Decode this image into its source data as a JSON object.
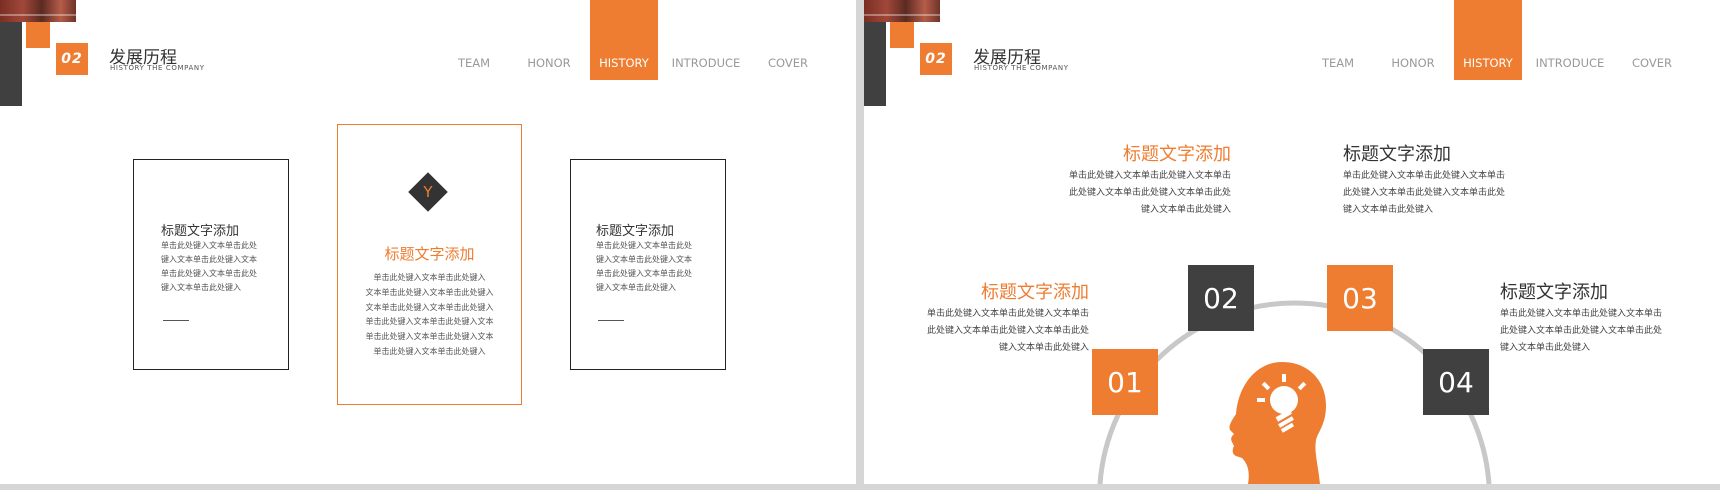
{
  "header": {
    "num": "02",
    "title": "发展历程",
    "subtitle": "HISTORY  THE  COMPANY"
  },
  "nav": [
    "TEAM",
    "HONOR",
    "HISTORY",
    "INTRODUCE",
    "COVER"
  ],
  "nav_active": "HISTORY",
  "left_slide": {
    "card1": {
      "title": "标题文字添加",
      "lines": [
        "单击此处键入文本单击此处",
        "键入文本单击此处键入文本",
        "单击此处键入文本单击此处",
        "键入文本单击此处键入"
      ]
    },
    "card2": {
      "icon_glyph": "Y",
      "title": "标题文字添加",
      "lines": [
        "单击此处键入文本单击此处键入",
        "文本单击此处键入文本单击此处键入",
        "文本单击此处键入文本单击此处键入",
        "单击此处键入文本单击此处键入文本",
        "单击此处键入文本单击此处键入文本",
        "单击此处键入文本单击此处键入"
      ]
    },
    "card3": {
      "title": "标题文字添加",
      "lines": [
        "单击此处键入文本单击此处",
        "键入文本单击此处键入文本",
        "单击此处键入文本单击此处",
        "键入文本单击此处键入"
      ]
    }
  },
  "right_slide": {
    "items": [
      {
        "num": "01",
        "title": "标题文字添加",
        "lines": [
          "单击此处键入文本单击此处键入文本单击",
          "此处键入文本单击此处键入文本单击此处",
          "键入文本单击此处键入"
        ]
      },
      {
        "num": "02",
        "title": "标题文字添加",
        "lines": [
          "单击此处键入文本单击此处键入文本单击",
          "此处键入文本单击此处键入文本单击此处",
          "键入文本单击此处键入"
        ]
      },
      {
        "num": "03",
        "title": "标题文字添加",
        "lines": [
          "单击此处键入文本单击此处键入文本单击",
          "此处键入文本单击此处键入文本单击此处",
          "键入文本单击此处键入"
        ]
      },
      {
        "num": "04",
        "title": "标题文字添加",
        "lines": [
          "单击此处键入文本单击此处键入文本单击",
          "此处键入文本单击此处键入文本单击此处",
          "键入文本单击此处键入"
        ]
      }
    ],
    "icon": "head-lightbulb-icon"
  },
  "colors": {
    "accent": "#ee7d32",
    "dark": "#404040",
    "arc": "#c8c8c8"
  }
}
